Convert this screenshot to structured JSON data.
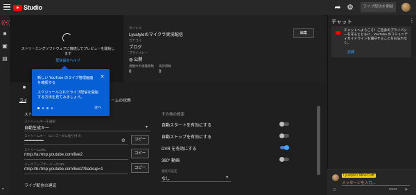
{
  "header": {
    "logo_text": "Studio",
    "go_live_label": "ライブ配信を開始"
  },
  "preview": {
    "message": "ストリーミングソフトウェアに接続してプレビューを開始します",
    "help_link": "配信設定ヘルプ"
  },
  "info": {
    "title_label": "タイトル",
    "title_value": "Lyustyleのマイクラ実況配信",
    "category_label": "カテゴリ",
    "category_value": "ブログ",
    "privacy_label": "プライバシー",
    "privacy_value": "公開",
    "viewers_label": "視聴中の視聴者数",
    "viewers_value": "0",
    "likes_label": "高評価数",
    "likes_value": "0",
    "edit_label": "編集"
  },
  "tabs": {
    "tab1": "ライ",
    "tab2": "ームの状態"
  },
  "tooltip": {
    "title": "新しい YouTube のライブ管理画面を確認する",
    "body": "スケジュールされたライブ配信を開始する方法を見てみましょう。",
    "next_label": "次へ"
  },
  "stream": {
    "section_label": "スト",
    "key_select_label": "ストリームキーを選択",
    "key_select_value": "自動生成キー",
    "key_label": "ストリームキー（エンコーダに貼り付け）",
    "key_value": "••••••••••••••••••••••",
    "url_label": "ストリームURL",
    "url_value": "rtmp://a.rtmp.youtube.com/live2",
    "backup_label": "バックアップサーバーのURL",
    "backup_value": "rtmp://b.rtmp.youtube.com/live2?backup=1",
    "copy_label": "コピー",
    "latency_label": "ライブ配信の遅延"
  },
  "other_settings": {
    "heading": "その他の設定",
    "auto_start": "自動スタートを有効にする",
    "auto_stop": "自動ストップを有効にする",
    "dvr": "DVR を有効にする",
    "video360": "360° 動画",
    "delay_label": "遅延の設定",
    "delay_value": "なし",
    "dvr_on": true
  },
  "chat": {
    "title": "チャット",
    "notice": "チャットへようこそ！ご自身のプライバシーを守るとともに、YouTube のコミュニティガイドラインを遵守することをお忘れなく。",
    "notice_link": "詳細",
    "user_name": "Lyustyle's MineCraft",
    "placeholder": "メッセージを入力...",
    "count": "0/200"
  },
  "icons": {
    "menu": "hamburger-icon",
    "share": "share-icon",
    "settings": "gear-icon",
    "live": "live-broadcast-icon",
    "camera": "camera-icon",
    "calendar": "calendar-icon",
    "manage": "manage-icon",
    "emoji": "emoji-icon",
    "send": "send-icon"
  },
  "colors": {
    "brand_red": "#ff0000",
    "accent_blue": "#065fd4",
    "link_blue": "#3ea6ff",
    "highlight_yellow": "#ffd600"
  }
}
